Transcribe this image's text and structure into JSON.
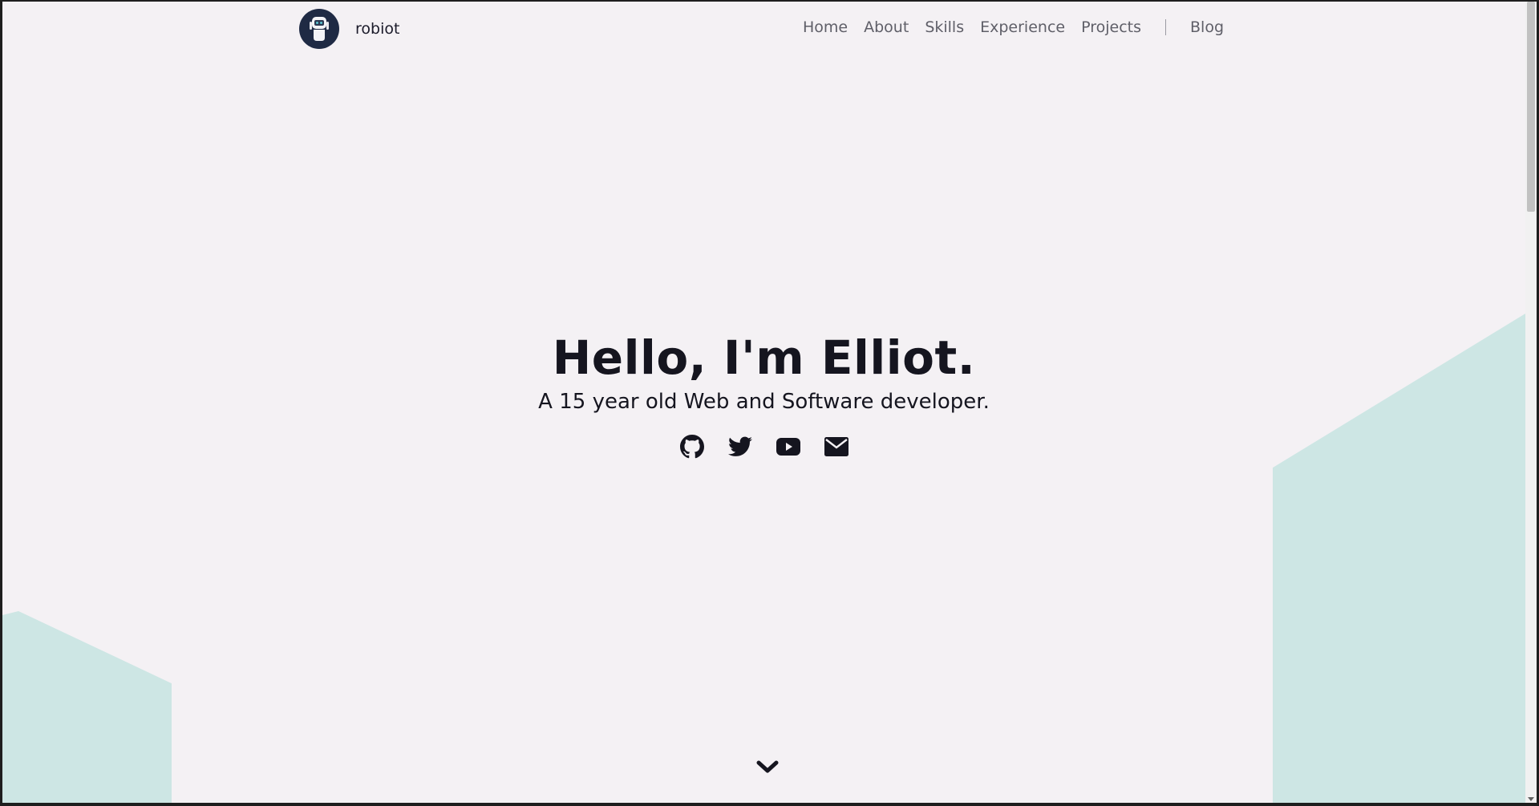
{
  "brand": {
    "name": "robiot",
    "logo_icon": "robot-icon"
  },
  "nav": {
    "items": [
      {
        "label": "Home"
      },
      {
        "label": "About"
      },
      {
        "label": "Skills"
      },
      {
        "label": "Experience"
      },
      {
        "label": "Projects"
      }
    ],
    "blog_label": "Blog"
  },
  "hero": {
    "title": "Hello, I'm Elliot.",
    "subtitle": "A 15 year old Web and Software developer."
  },
  "social": [
    {
      "icon": "github-icon"
    },
    {
      "icon": "twitter-icon"
    },
    {
      "icon": "youtube-icon"
    },
    {
      "icon": "mail-icon"
    }
  ],
  "scroll_icon": "chevron-down-icon",
  "colors": {
    "background": "#f4f1f4",
    "accent_shape": "#cde6e4",
    "text": "#15151f",
    "nav_text": "#5f5f68",
    "logo_bg": "#1f2a44"
  }
}
